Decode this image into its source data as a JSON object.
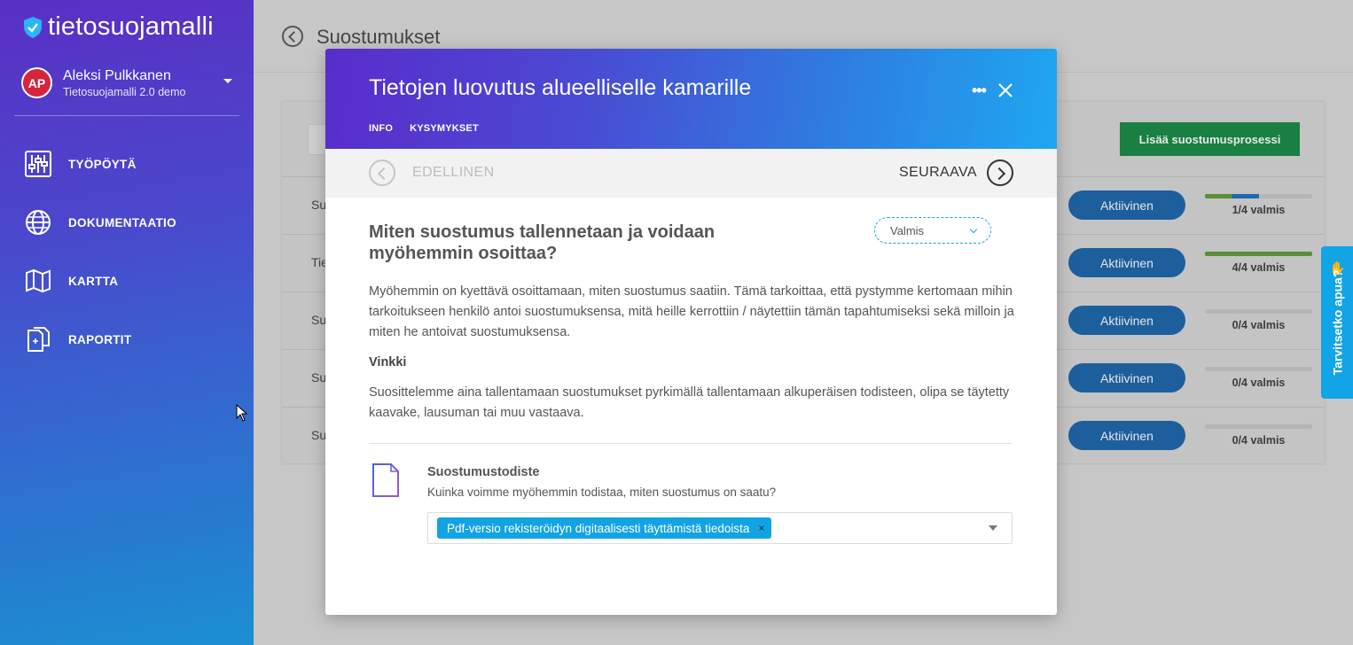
{
  "brand": {
    "name": "tietosuojamalli",
    "icon": "shield-check-icon"
  },
  "user": {
    "initials": "AP",
    "name": "Aleksi Pulkkanen",
    "org": "Tietosuojamalli 2.0 demo"
  },
  "nav": [
    {
      "label": "TYÖPÖYTÄ",
      "icon": "sliders-icon"
    },
    {
      "label": "DOKUMENTAATIO",
      "icon": "globe-icon"
    },
    {
      "label": "KARTTA",
      "icon": "map-icon"
    },
    {
      "label": "RAPORTIT",
      "icon": "reports-icon"
    }
  ],
  "page": {
    "title": "Suostumukset",
    "add_button": "Lisää suostumusprosessi"
  },
  "rows": [
    {
      "name": "Su",
      "status": "Aktiivinen",
      "progress_text": "1/4 valmis",
      "progress": 0.5
    },
    {
      "name": "Tie",
      "status": "Aktiivinen",
      "progress_text": "4/4 valmis",
      "progress": 1.0
    },
    {
      "name": "Su",
      "status": "Aktiivinen",
      "progress_text": "0/4 valmis",
      "progress": 0
    },
    {
      "name": "Su",
      "status": "Aktiivinen",
      "progress_text": "0/4 valmis",
      "progress": 0
    },
    {
      "name": "Su",
      "status": "Aktiivinen",
      "progress_text": "0/4 valmis",
      "progress": 0
    }
  ],
  "help": {
    "label": "Tarvitsetko apua?"
  },
  "modal": {
    "title": "Tietojen luovutus alueelliselle kamarille",
    "more": "•••",
    "tabs": [
      "INFO",
      "KYSYMYKSET"
    ],
    "prev": "EDELLINEN",
    "next": "SEURAAVA",
    "question": "Miten suostumus tallennetaan ja voidaan myöhemmin osoittaa?",
    "status": "Valmis",
    "description": "Myöhemmin on kyettävä osoittamaan, miten suostumus saatiin. Tämä tarkoittaa, että pystymme kertomaan mihin tarkoitukseen henkilö antoi suostumuksensa, mitä heille kerrottiin / näytettiin tämän tapahtumiseksi sekä milloin ja miten he antoivat suostumuksensa.",
    "tip_title": "Vinkki",
    "tip_text": "Suosittelemme aina tallentamaan suostumukset pyrkimällä tallentamaan alkuperäisen todisteen, olipa se täytetty kaavake, lausuman tai muu vastaava.",
    "evidence_title": "Suostumustodiste",
    "evidence_question": "Kuinka voimme myöhemmin todistaa, miten suostumus on saatu?",
    "evidence_tag": "Pdf-versio rekisteröidyn digitaalisesti täyttämistä tiedoista",
    "tag_remove": "×"
  }
}
